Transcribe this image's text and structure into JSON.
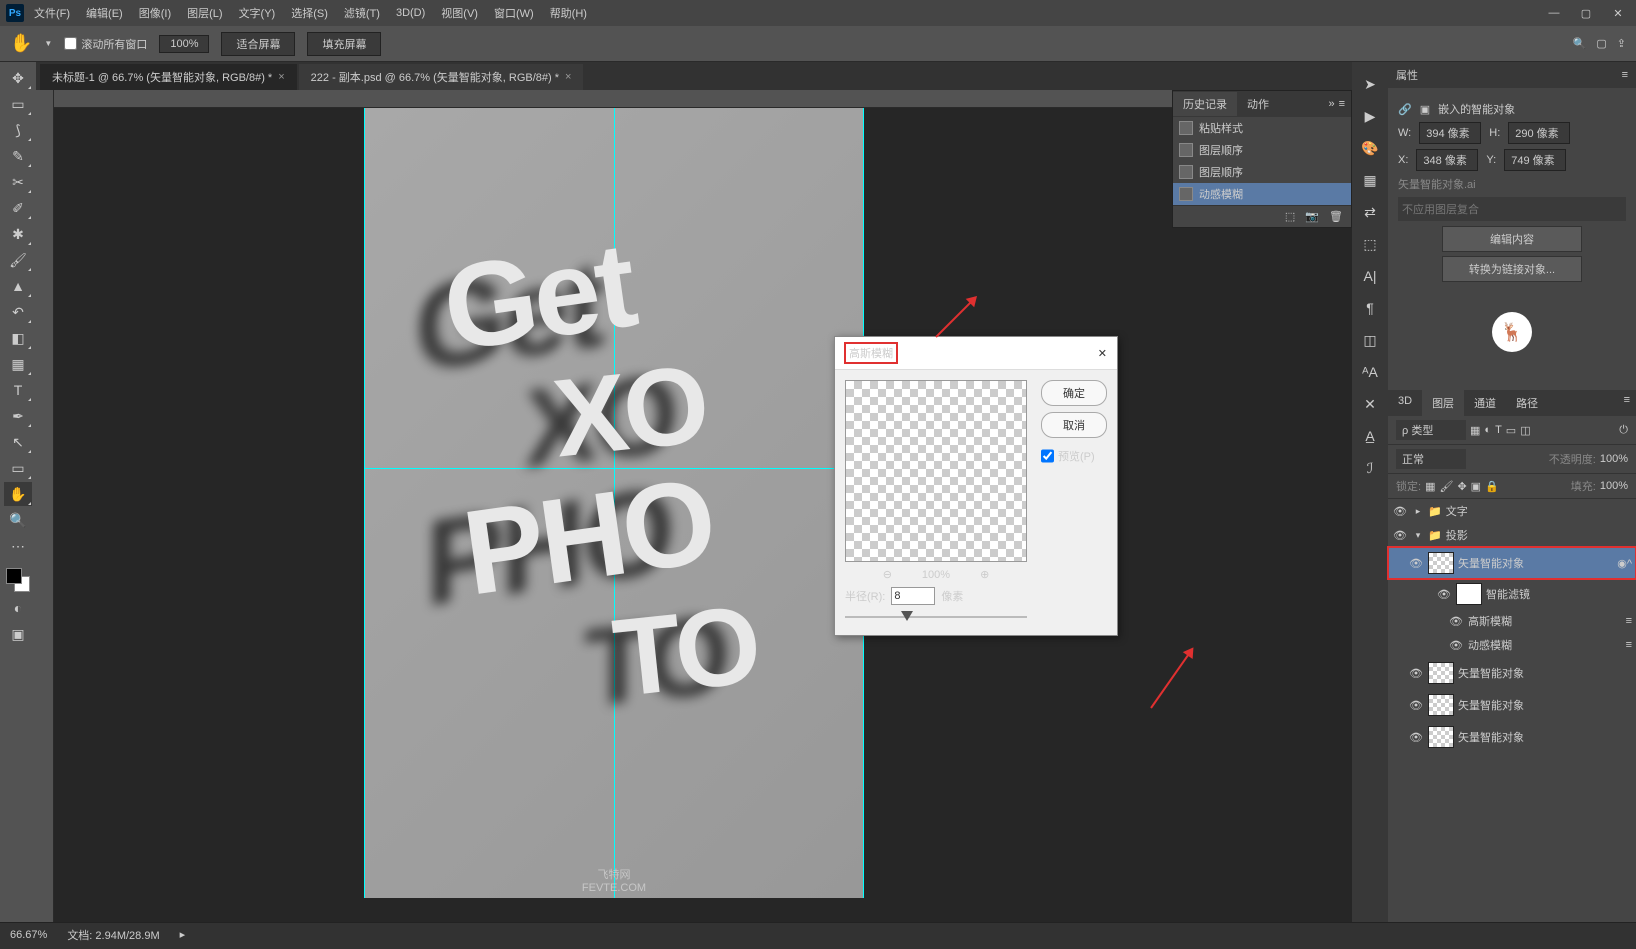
{
  "menu": {
    "items": [
      "文件(F)",
      "编辑(E)",
      "图像(I)",
      "图层(L)",
      "文字(Y)",
      "选择(S)",
      "滤镜(T)",
      "3D(D)",
      "视图(V)",
      "窗口(W)",
      "帮助(H)"
    ]
  },
  "optbar": {
    "scroll_all": "滚动所有窗口",
    "zoom": "100%",
    "fit": "适合屏幕",
    "fill": "填充屏幕"
  },
  "tabs": {
    "t1": "未标题-1 @ 66.7% (矢量智能对象, RGB/8#) *",
    "t2": "222 - 副本.psd @ 66.7% (矢量智能对象, RGB/8#) *"
  },
  "canvas": {
    "words": [
      "Get",
      "XO",
      "PHO",
      "TO"
    ],
    "wm1": "飞特网",
    "wm2": "FEVTE.COM"
  },
  "history": {
    "tab1": "历史记录",
    "tab2": "动作",
    "items": [
      "粘贴样式",
      "图层顺序",
      "图层顺序",
      "动感模糊"
    ]
  },
  "props": {
    "title": "属性",
    "kind": "嵌入的智能对象",
    "w": "394 像素",
    "h": "290 像素",
    "x": "348 像素",
    "y": "749 像素",
    "file": "矢量智能对象.ai",
    "comp": "不应用图层复合",
    "edit": "编辑内容",
    "convert": "转换为链接对象..."
  },
  "layers": {
    "tabs": [
      "3D",
      "图层",
      "通道",
      "路径"
    ],
    "filter": "ρ 类型",
    "blend": "正常",
    "opacity_lbl": "不透明度:",
    "opacity": "100%",
    "lock_lbl": "锁定:",
    "fill_lbl": "填充:",
    "fill": "100%",
    "group_text": "文字",
    "group_shadow": "投影",
    "so": "矢量智能对象",
    "sf": "智能滤镜",
    "gb": "高斯模糊",
    "mb": "动感模糊"
  },
  "status": {
    "zoom": "66.67%",
    "doc": "文档: 2.94M/28.9M"
  },
  "dialog": {
    "title": "高斯模糊",
    "ok": "确定",
    "cancel": "取消",
    "preview": "预览(P)",
    "zoom": "100%",
    "radius_lbl": "半径(R):",
    "radius": "8",
    "unit": "像素"
  }
}
